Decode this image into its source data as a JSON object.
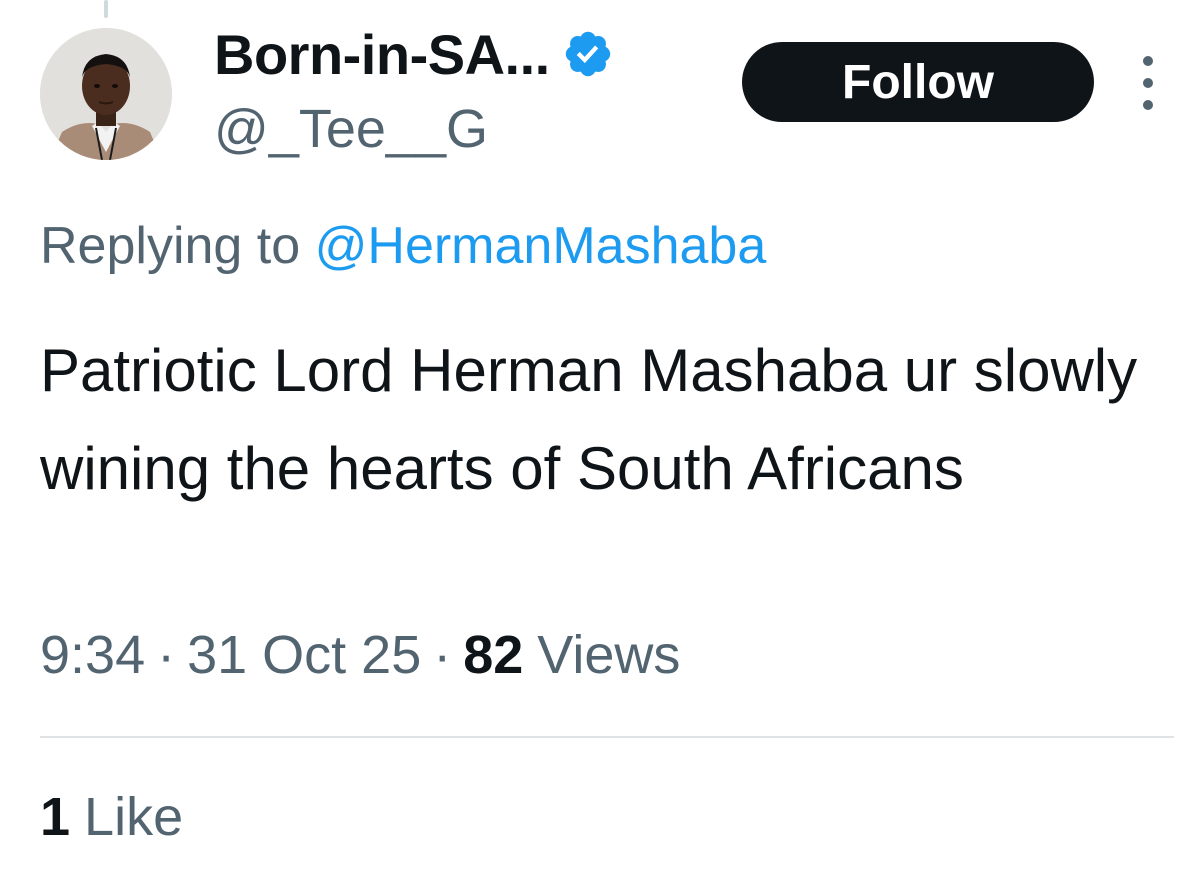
{
  "author": {
    "display_name": "Born-in-SA...",
    "handle": "@_Tee__G",
    "verified_icon": "verified-badge-icon",
    "verified_color": "#1d9bf0"
  },
  "actions": {
    "follow_label": "Follow",
    "more_icon": "more-vertical-icon"
  },
  "reply": {
    "prefix": "Replying to",
    "mention": "@HermanMashaba"
  },
  "tweet": {
    "text": "Patriotic Lord Herman Mashaba ur slowly wining the hearts of South Africans"
  },
  "meta": {
    "time": "9:34",
    "separator": "·",
    "date": "31 Oct 25",
    "views_count": "82",
    "views_label": "Views"
  },
  "engagement": {
    "likes_count": "1",
    "likes_label": "Like"
  },
  "colors": {
    "text_primary": "#0f1419",
    "text_secondary": "#536471",
    "link": "#1d9bf0",
    "button_bg": "#0f1419",
    "button_text": "#ffffff"
  }
}
